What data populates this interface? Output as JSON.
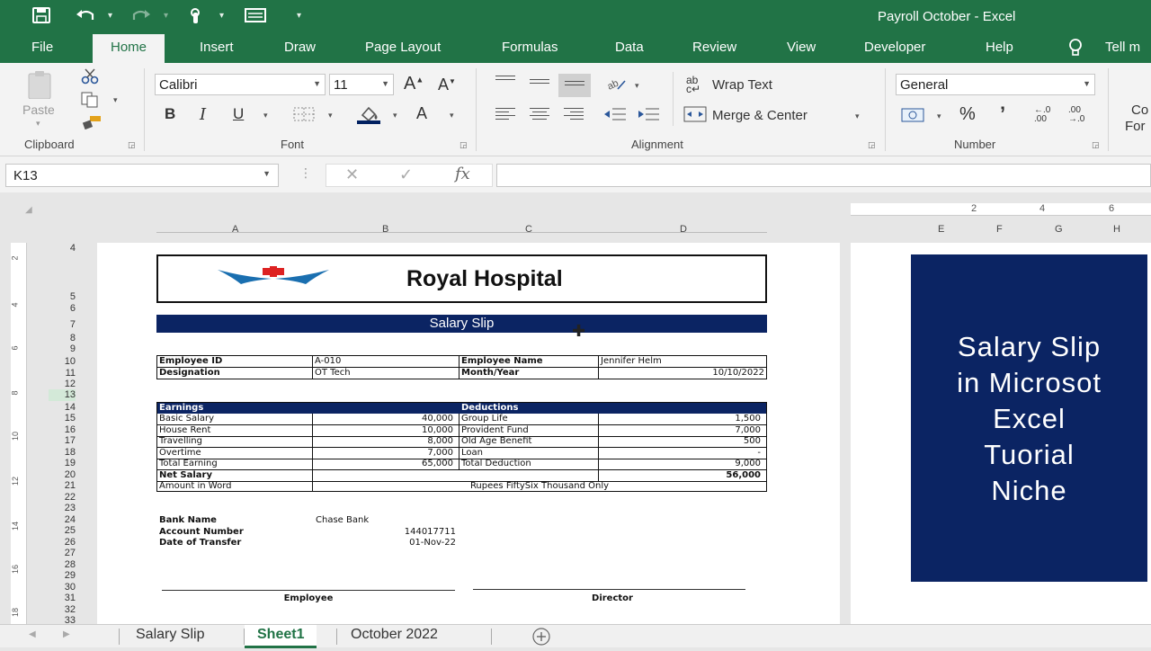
{
  "window": {
    "title": "Payroll October  -  Excel"
  },
  "menu": [
    "File",
    "Home",
    "Insert",
    "Draw",
    "Page Layout",
    "Formulas",
    "Data",
    "Review",
    "View",
    "Developer",
    "Help",
    "Tell m"
  ],
  "ribbon": {
    "clipboard": {
      "paste_label": "Paste",
      "group_label": "Clipboard"
    },
    "font": {
      "font_name": "Calibri",
      "font_size": "11",
      "bold": "B",
      "italic": "I",
      "underline": "U",
      "group_label": "Font"
    },
    "alignment": {
      "wrap_text": "Wrap Text",
      "merge_center": "Merge & Center",
      "group_label": "Alignment"
    },
    "number": {
      "format": "General",
      "percent": "%",
      "comma": "’",
      "group_label": "Number"
    },
    "styles": {
      "conditional_line1": "Co",
      "conditional_line2": "For"
    }
  },
  "formula_bar": {
    "name_box": "K13",
    "fx": "fx",
    "formula": ""
  },
  "columns": {
    "left": [
      "A",
      "B",
      "C",
      "D"
    ],
    "right": [
      "E",
      "F",
      "G",
      "H"
    ]
  },
  "ruler_numbers": {
    "top": [
      "2",
      "4",
      "6"
    ],
    "left": [
      "2",
      "4",
      "6",
      "8",
      "10",
      "12",
      "14",
      "16",
      "18"
    ]
  },
  "row_numbers": [
    "4",
    "5",
    "6",
    "7",
    "8",
    "9",
    "10",
    "11",
    "12",
    "13",
    "14",
    "15",
    "16",
    "17",
    "18",
    "19",
    "20",
    "21",
    "22",
    "23",
    "24",
    "25",
    "26",
    "27",
    "28",
    "29",
    "30",
    "31",
    "32",
    "33"
  ],
  "slip": {
    "hospital": "Royal Hospital",
    "banner": "Salary Slip",
    "info": {
      "employee_id_label": "Employee ID",
      "employee_id": "A-010",
      "employee_name_label": "Employee Name",
      "employee_name": "Jennifer Helm",
      "designation_label": "Designation",
      "designation": "OT Tech",
      "month_year_label": "Month/Year",
      "month_year": "10/10/2022"
    },
    "earnings_header": "Earnings",
    "deductions_header": "Deductions",
    "earnings": [
      {
        "label": "Basic Salary",
        "value": "40,000"
      },
      {
        "label": "House Rent",
        "value": "10,000"
      },
      {
        "label": "Travelling",
        "value": "8,000"
      },
      {
        "label": "Overtime",
        "value": "7,000"
      },
      {
        "label": "Total Earning",
        "value": "65,000"
      }
    ],
    "deductions": [
      {
        "label": "Group Life",
        "value": "1,500"
      },
      {
        "label": "Provident Fund",
        "value": "7,000"
      },
      {
        "label": "Old Age Benefit",
        "value": "500"
      },
      {
        "label": "Loan",
        "value": "-"
      },
      {
        "label": "Total Deduction",
        "value": "9,000"
      }
    ],
    "net_salary_label": "Net Salary",
    "net_salary": "56,000",
    "amount_in_word_label": "Amount in Word",
    "amount_in_word": "Rupees FiftySix Thousand  Only",
    "bank": {
      "bank_name_label": "Bank Name",
      "bank_name": "Chase Bank",
      "account_label": "Account Number",
      "account": "144017711",
      "date_label": "Date of Transfer",
      "date": "01-Nov-22"
    },
    "sign_employee": "Employee",
    "sign_director": "Director"
  },
  "promo": {
    "line1": "Salary Slip",
    "line2": "in Microsot",
    "line3": "Excel",
    "line4": "Tuorial",
    "line5": "Niche"
  },
  "sheet_tabs": [
    "Salary Slip",
    "Sheet1",
    "October 2022"
  ],
  "colors": {
    "excel_green": "#217346",
    "navy": "#0b2463"
  }
}
